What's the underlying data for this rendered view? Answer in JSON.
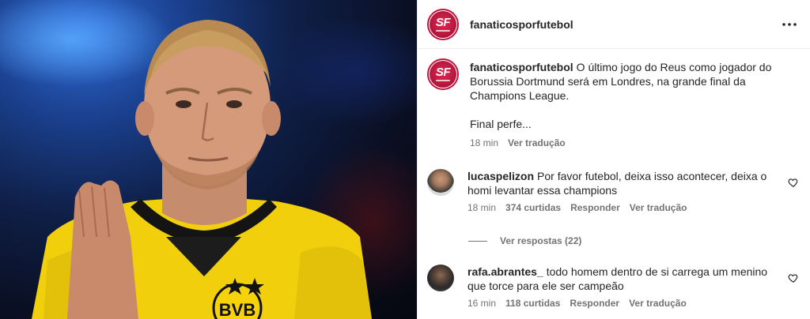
{
  "post": {
    "account": "fanaticosporfutebol",
    "avatar_text": "SF",
    "caption": {
      "username": "fanaticosporfutebol",
      "text": "O último jogo do Reus como jogador do Borussia Dortmund será em Londres, na grande final da Champions League.",
      "extra": "Final perfe...",
      "time": "18 min",
      "translate": "Ver tradução"
    }
  },
  "comments": [
    {
      "username": "lucaspelizon",
      "text": "Por favor futebol, deixa isso acontecer, deixa o homi levantar essa champions",
      "time": "18 min",
      "likes": "374 curtidas",
      "reply": "Responder",
      "translate": "Ver tradução",
      "view_replies": "Ver respostas (22)"
    },
    {
      "username": "rafa.abrantes_",
      "text": "todo homem dentro de si carrega um menino que torce para ele ser campeão",
      "time": "16 min",
      "likes": "118 curtidas",
      "reply": "Responder",
      "translate": "Ver tradução"
    }
  ],
  "media": {
    "jersey_text": "BVB",
    "jersey_color": "#f5d20a",
    "background_color": "#0a0f22"
  },
  "icons": {
    "more": "more-horizontal-icon",
    "like": "heart-outline-icon"
  }
}
